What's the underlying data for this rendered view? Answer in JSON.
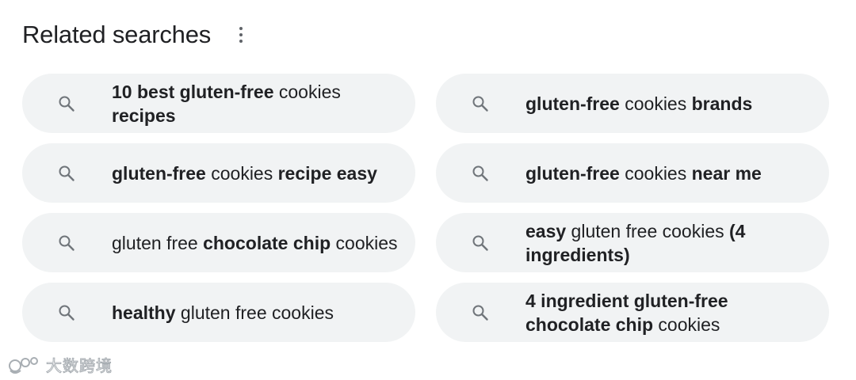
{
  "header": {
    "title": "Related searches",
    "more_icon": "more-vert-icon"
  },
  "search_icon": "search-icon",
  "searches": [
    {
      "segments": [
        {
          "text": "10 best gluten-free",
          "bold": true
        },
        {
          "text": " cookies ",
          "bold": false
        },
        {
          "text": "recipes",
          "bold": true
        }
      ]
    },
    {
      "segments": [
        {
          "text": "gluten-free",
          "bold": true
        },
        {
          "text": " cookies ",
          "bold": false
        },
        {
          "text": "brands",
          "bold": true
        }
      ]
    },
    {
      "segments": [
        {
          "text": "gluten-free",
          "bold": true
        },
        {
          "text": " cookies ",
          "bold": false
        },
        {
          "text": "recipe easy",
          "bold": true
        }
      ]
    },
    {
      "segments": [
        {
          "text": "gluten-free",
          "bold": true
        },
        {
          "text": " cookies ",
          "bold": false
        },
        {
          "text": "near me",
          "bold": true
        }
      ]
    },
    {
      "segments": [
        {
          "text": "gluten free ",
          "bold": false
        },
        {
          "text": "chocolate chip",
          "bold": true
        },
        {
          "text": " cookies",
          "bold": false
        }
      ]
    },
    {
      "segments": [
        {
          "text": "easy",
          "bold": true
        },
        {
          "text": " gluten free cookies ",
          "bold": false
        },
        {
          "text": "(4 ingredients)",
          "bold": true
        }
      ]
    },
    {
      "segments": [
        {
          "text": "healthy",
          "bold": true
        },
        {
          "text": " gluten free cookies",
          "bold": false
        }
      ]
    },
    {
      "segments": [
        {
          "text": "4 ingredient gluten-free chocolate chip",
          "bold": true
        },
        {
          "text": " cookies",
          "bold": false
        }
      ]
    }
  ],
  "watermark": {
    "text": "大数跨境"
  }
}
